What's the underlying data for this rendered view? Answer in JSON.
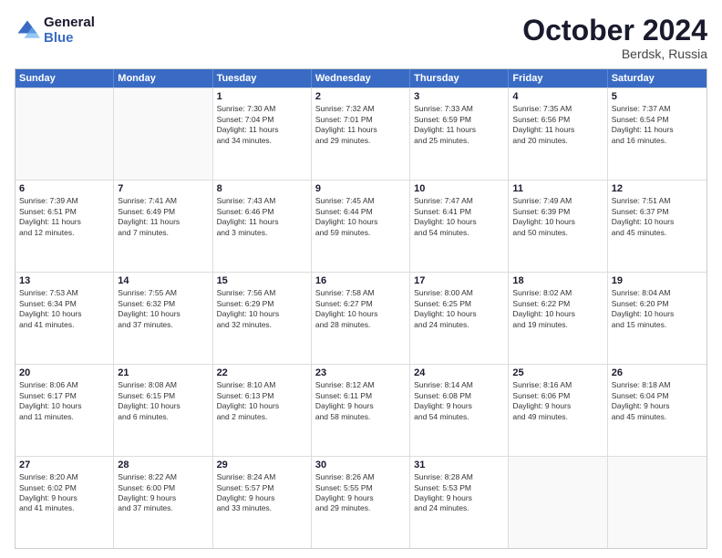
{
  "logo": {
    "line1": "General",
    "line2": "Blue"
  },
  "title": "October 2024",
  "subtitle": "Berdsk, Russia",
  "days": [
    "Sunday",
    "Monday",
    "Tuesday",
    "Wednesday",
    "Thursday",
    "Friday",
    "Saturday"
  ],
  "weeks": [
    [
      {
        "num": "",
        "text": ""
      },
      {
        "num": "",
        "text": ""
      },
      {
        "num": "1",
        "text": "Sunrise: 7:30 AM\nSunset: 7:04 PM\nDaylight: 11 hours\nand 34 minutes."
      },
      {
        "num": "2",
        "text": "Sunrise: 7:32 AM\nSunset: 7:01 PM\nDaylight: 11 hours\nand 29 minutes."
      },
      {
        "num": "3",
        "text": "Sunrise: 7:33 AM\nSunset: 6:59 PM\nDaylight: 11 hours\nand 25 minutes."
      },
      {
        "num": "4",
        "text": "Sunrise: 7:35 AM\nSunset: 6:56 PM\nDaylight: 11 hours\nand 20 minutes."
      },
      {
        "num": "5",
        "text": "Sunrise: 7:37 AM\nSunset: 6:54 PM\nDaylight: 11 hours\nand 16 minutes."
      }
    ],
    [
      {
        "num": "6",
        "text": "Sunrise: 7:39 AM\nSunset: 6:51 PM\nDaylight: 11 hours\nand 12 minutes."
      },
      {
        "num": "7",
        "text": "Sunrise: 7:41 AM\nSunset: 6:49 PM\nDaylight: 11 hours\nand 7 minutes."
      },
      {
        "num": "8",
        "text": "Sunrise: 7:43 AM\nSunset: 6:46 PM\nDaylight: 11 hours\nand 3 minutes."
      },
      {
        "num": "9",
        "text": "Sunrise: 7:45 AM\nSunset: 6:44 PM\nDaylight: 10 hours\nand 59 minutes."
      },
      {
        "num": "10",
        "text": "Sunrise: 7:47 AM\nSunset: 6:41 PM\nDaylight: 10 hours\nand 54 minutes."
      },
      {
        "num": "11",
        "text": "Sunrise: 7:49 AM\nSunset: 6:39 PM\nDaylight: 10 hours\nand 50 minutes."
      },
      {
        "num": "12",
        "text": "Sunrise: 7:51 AM\nSunset: 6:37 PM\nDaylight: 10 hours\nand 45 minutes."
      }
    ],
    [
      {
        "num": "13",
        "text": "Sunrise: 7:53 AM\nSunset: 6:34 PM\nDaylight: 10 hours\nand 41 minutes."
      },
      {
        "num": "14",
        "text": "Sunrise: 7:55 AM\nSunset: 6:32 PM\nDaylight: 10 hours\nand 37 minutes."
      },
      {
        "num": "15",
        "text": "Sunrise: 7:56 AM\nSunset: 6:29 PM\nDaylight: 10 hours\nand 32 minutes."
      },
      {
        "num": "16",
        "text": "Sunrise: 7:58 AM\nSunset: 6:27 PM\nDaylight: 10 hours\nand 28 minutes."
      },
      {
        "num": "17",
        "text": "Sunrise: 8:00 AM\nSunset: 6:25 PM\nDaylight: 10 hours\nand 24 minutes."
      },
      {
        "num": "18",
        "text": "Sunrise: 8:02 AM\nSunset: 6:22 PM\nDaylight: 10 hours\nand 19 minutes."
      },
      {
        "num": "19",
        "text": "Sunrise: 8:04 AM\nSunset: 6:20 PM\nDaylight: 10 hours\nand 15 minutes."
      }
    ],
    [
      {
        "num": "20",
        "text": "Sunrise: 8:06 AM\nSunset: 6:17 PM\nDaylight: 10 hours\nand 11 minutes."
      },
      {
        "num": "21",
        "text": "Sunrise: 8:08 AM\nSunset: 6:15 PM\nDaylight: 10 hours\nand 6 minutes."
      },
      {
        "num": "22",
        "text": "Sunrise: 8:10 AM\nSunset: 6:13 PM\nDaylight: 10 hours\nand 2 minutes."
      },
      {
        "num": "23",
        "text": "Sunrise: 8:12 AM\nSunset: 6:11 PM\nDaylight: 9 hours\nand 58 minutes."
      },
      {
        "num": "24",
        "text": "Sunrise: 8:14 AM\nSunset: 6:08 PM\nDaylight: 9 hours\nand 54 minutes."
      },
      {
        "num": "25",
        "text": "Sunrise: 8:16 AM\nSunset: 6:06 PM\nDaylight: 9 hours\nand 49 minutes."
      },
      {
        "num": "26",
        "text": "Sunrise: 8:18 AM\nSunset: 6:04 PM\nDaylight: 9 hours\nand 45 minutes."
      }
    ],
    [
      {
        "num": "27",
        "text": "Sunrise: 8:20 AM\nSunset: 6:02 PM\nDaylight: 9 hours\nand 41 minutes."
      },
      {
        "num": "28",
        "text": "Sunrise: 8:22 AM\nSunset: 6:00 PM\nDaylight: 9 hours\nand 37 minutes."
      },
      {
        "num": "29",
        "text": "Sunrise: 8:24 AM\nSunset: 5:57 PM\nDaylight: 9 hours\nand 33 minutes."
      },
      {
        "num": "30",
        "text": "Sunrise: 8:26 AM\nSunset: 5:55 PM\nDaylight: 9 hours\nand 29 minutes."
      },
      {
        "num": "31",
        "text": "Sunrise: 8:28 AM\nSunset: 5:53 PM\nDaylight: 9 hours\nand 24 minutes."
      },
      {
        "num": "",
        "text": ""
      },
      {
        "num": "",
        "text": ""
      }
    ]
  ]
}
